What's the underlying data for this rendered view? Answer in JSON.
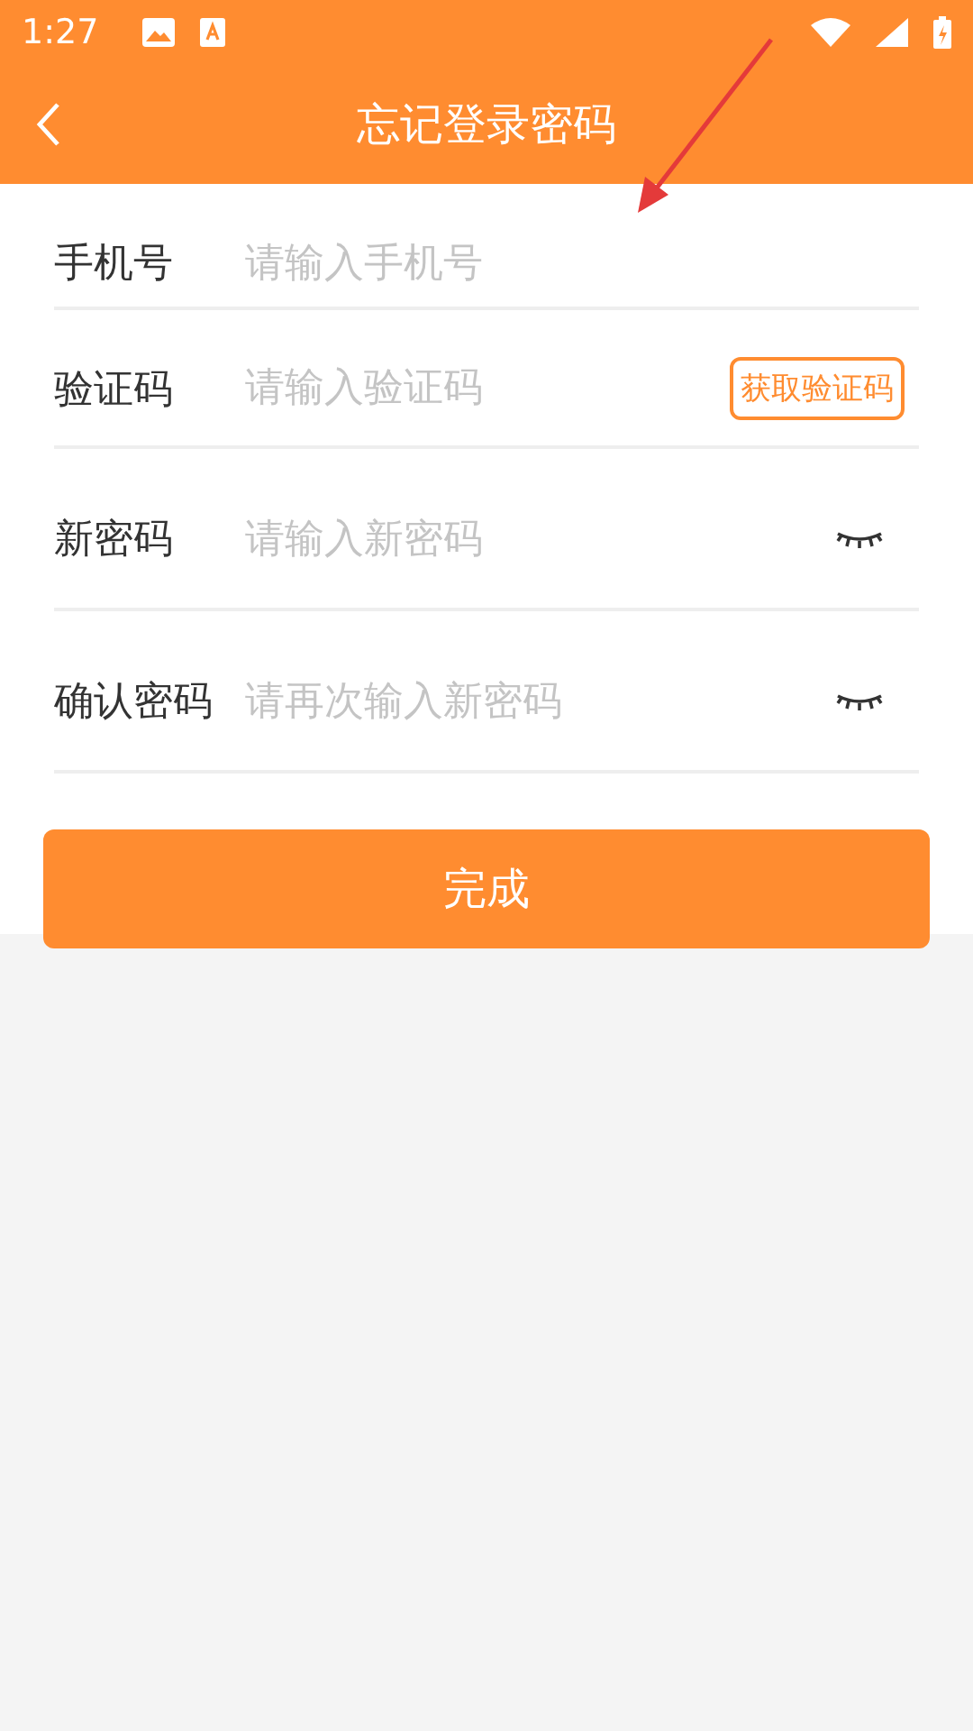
{
  "status_bar": {
    "time": "1:27"
  },
  "header": {
    "title": "忘记登录密码"
  },
  "fields": [
    {
      "kind": "text",
      "label": "手机号",
      "placeholder": "请输入手机号"
    },
    {
      "kind": "code",
      "label": "验证码",
      "placeholder": "请输入验证码",
      "action": "获取验证码"
    },
    {
      "kind": "password",
      "label": "新密码",
      "placeholder": "请输入新密码"
    },
    {
      "kind": "password",
      "label": "确认密码",
      "placeholder": "请再次输入新密码"
    }
  ],
  "submit": "完成"
}
